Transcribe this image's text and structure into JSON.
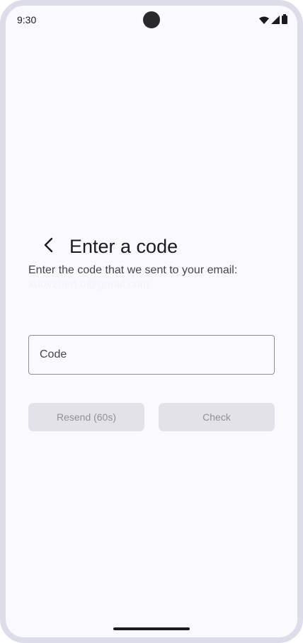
{
  "status_bar": {
    "time": "9:30"
  },
  "header": {
    "title": "Enter a code",
    "back_icon": "chevron-left-icon"
  },
  "body": {
    "instruction": "Enter the code that we sent to your email:",
    "email": "kuovzhen.o@gmail.com"
  },
  "code_input": {
    "placeholder": "Code",
    "value": ""
  },
  "actions": {
    "resend_label": "Resend (60s)",
    "check_label": "Check"
  },
  "colors": {
    "background": "#f9f9ff",
    "frame": "#dddde9",
    "disabled_button": "#e3e2e8",
    "disabled_text": "#8f8f96"
  }
}
